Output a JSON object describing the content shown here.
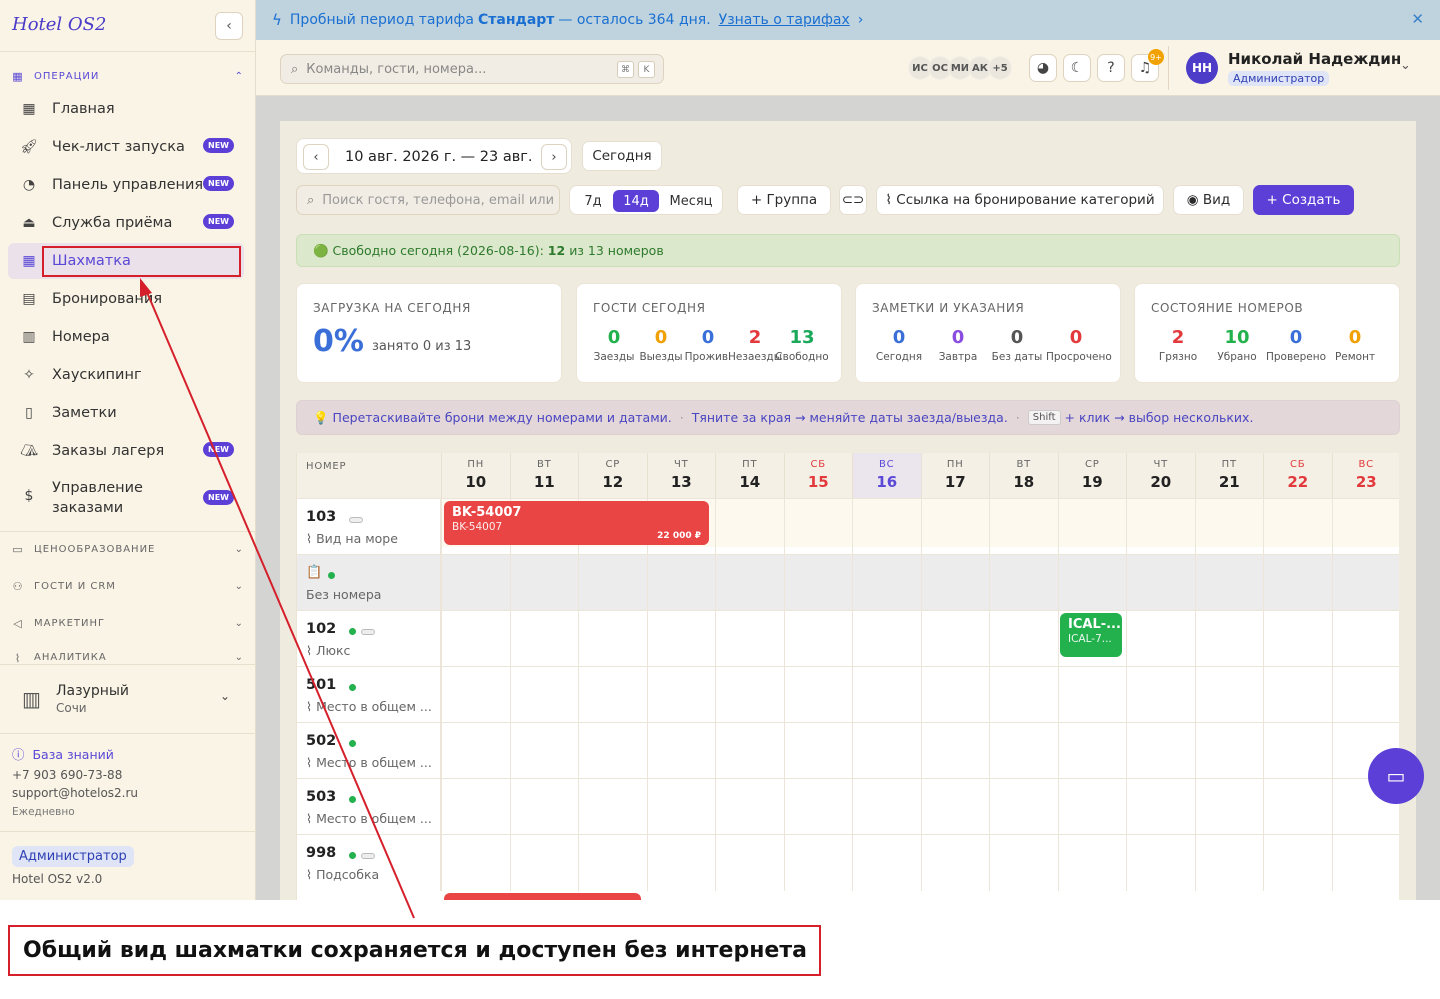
{
  "sidebar": {
    "logo": "Hotel OS2",
    "sections": {
      "operations": "ОПЕРАЦИИ",
      "pricing": "ЦЕНООБРАЗОВАНИЕ",
      "guests_crm": "ГОСТИ И CRM",
      "marketing": "МАРКЕТИНГ",
      "analytics": "АНАЛИТИКА"
    },
    "items": [
      {
        "label": "Главная"
      },
      {
        "label": "Чек-лист запуска",
        "badge": "NEW"
      },
      {
        "label": "Панель управления",
        "badge": "NEW"
      },
      {
        "label": "Служба приёма",
        "badge": "NEW"
      },
      {
        "label": "Шахматка"
      },
      {
        "label": "Бронирования"
      },
      {
        "label": "Номера"
      },
      {
        "label": "Хаускипинг"
      },
      {
        "label": "Заметки"
      },
      {
        "label": "Заказы лагеря",
        "badge": "NEW"
      },
      {
        "label_line1": "Управление",
        "label_line2": "заказами",
        "badge": "NEW"
      }
    ],
    "hotel": {
      "name": "Лазурный",
      "city": "Сочи"
    },
    "kb_link": "База знаний",
    "phone": "+7 903 690-73-88",
    "email": "support@hotelos2.ru",
    "hours": "Ежедневно",
    "role": "Администратор",
    "version": "Hotel OS2 v2.0"
  },
  "banner": {
    "text_before": "Пробный период тарифа",
    "plan": "Стандарт",
    "text_after": "— осталось 364 дня.",
    "link": "Узнать о тарифах"
  },
  "header": {
    "search_placeholder": "Команды, гости, номера...",
    "kbd1": "⌘",
    "kbd2": "K",
    "avatars": [
      "ИС",
      "ОС",
      "МИ",
      "АК",
      "+5"
    ],
    "notif_count": "9+",
    "user_initials": "НН",
    "user_name": "Николай Надеждин",
    "user_role": "Администратор"
  },
  "toolbar": {
    "date_range": "10 авг. 2026 г. — 23 авг.",
    "today": "Сегодня",
    "guest_search_placeholder": "Поиск гостя, телефона, email или",
    "ranges": [
      "7д",
      "14д",
      "Месяц"
    ],
    "active_range": "14д",
    "group": "Группа",
    "booking_link": "Ссылка на бронирование категорий",
    "view": "Вид",
    "create": "Создать"
  },
  "free_today": {
    "prefix": "Свободно сегодня (2026-08-16):",
    "count": "12",
    "suffix": "из 13 номеров"
  },
  "stats": {
    "load": {
      "title": "ЗАГРУЗКА НА СЕГОДНЯ",
      "value": "0%",
      "sub": "занято 0 из 13"
    },
    "guests": {
      "title": "ГОСТИ СЕГОДНЯ",
      "items": [
        {
          "v": "0",
          "l": "Заезды",
          "color": "#22b14c"
        },
        {
          "v": "0",
          "l": "Выезды",
          "color": "#f0a000"
        },
        {
          "v": "0",
          "l": "Прожив.",
          "color": "#3b6fd8"
        },
        {
          "v": "2",
          "l": "Незаезды",
          "color": "#e2393c"
        },
        {
          "v": "13",
          "l": "Свободно",
          "color": "#1aa85a"
        }
      ]
    },
    "notes": {
      "title": "ЗАМЕТКИ И УКАЗАНИЯ",
      "items": [
        {
          "v": "0",
          "l": "Сегодня",
          "color": "#3b6fd8"
        },
        {
          "v": "0",
          "l": "Завтра",
          "color": "#8a4de0"
        },
        {
          "v": "0",
          "l": "Без даты",
          "color": "#555555"
        },
        {
          "v": "0",
          "l": "Просрочено",
          "color": "#e2393c"
        }
      ]
    },
    "rooms": {
      "title": "СОСТОЯНИЕ НОМЕРОВ",
      "items": [
        {
          "v": "2",
          "l": "Грязно",
          "color": "#e2393c"
        },
        {
          "v": "10",
          "l": "Убрано",
          "color": "#22b14c"
        },
        {
          "v": "0",
          "l": "Проверено",
          "color": "#3b6fd8"
        },
        {
          "v": "0",
          "l": "Ремонт",
          "color": "#f0a000"
        }
      ]
    }
  },
  "hint": {
    "p1": "Перетаскивайте брони между номерами и датами.",
    "p2": "Тяните за края → меняйте даты заезда/выезда.",
    "key": "Shift",
    "p3": "+ клик → выбор нескольких."
  },
  "grid": {
    "room_header": "НОМЕР",
    "days": [
      {
        "w": "ПН",
        "d": "10"
      },
      {
        "w": "ВТ",
        "d": "11"
      },
      {
        "w": "СР",
        "d": "12"
      },
      {
        "w": "ЧТ",
        "d": "13"
      },
      {
        "w": "ПТ",
        "d": "14"
      },
      {
        "w": "СБ",
        "d": "15",
        "we": true
      },
      {
        "w": "ВС",
        "d": "16",
        "today": true
      },
      {
        "w": "ПН",
        "d": "17"
      },
      {
        "w": "ВТ",
        "d": "18"
      },
      {
        "w": "СР",
        "d": "19"
      },
      {
        "w": "ЧТ",
        "d": "20"
      },
      {
        "w": "ПТ",
        "d": "21"
      },
      {
        "w": "СБ",
        "d": "22",
        "we": true
      },
      {
        "w": "ВС",
        "d": "23",
        "we": true
      }
    ],
    "rows": [
      {
        "num": "103",
        "cat": "Вид на море"
      },
      {
        "num": "",
        "cat": "Без номера"
      },
      {
        "num": "102",
        "cat": "Люкс"
      },
      {
        "num": "501",
        "cat": "Место в общем ..."
      },
      {
        "num": "502",
        "cat": "Место в общем ..."
      },
      {
        "num": "503",
        "cat": "Место в общем ..."
      },
      {
        "num": "998",
        "cat": "Подсобка"
      }
    ],
    "bookings": [
      {
        "title": "BK-54007",
        "code": "BK-54007",
        "price": "22 000 ₽",
        "color": "#e94545"
      },
      {
        "title": "ICAL-...",
        "code": "ICAL-7...",
        "color": "#22b14c"
      }
    ]
  },
  "annotation": {
    "caption": "Общий вид шахматки сохраняется и доступен без интернета"
  }
}
